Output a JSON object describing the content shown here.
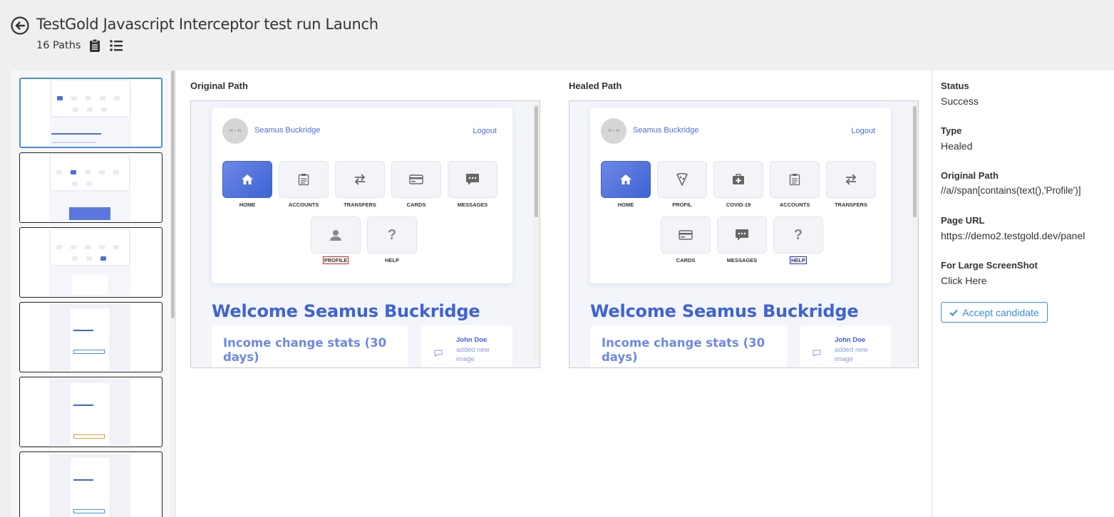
{
  "header": {
    "title": "TestGold Javascript Interceptor test run Launch",
    "paths_count": "16 Paths"
  },
  "panels": {
    "original_label": "Original Path",
    "healed_label": "Healed Path"
  },
  "app_preview": {
    "user_name": "Seamus Buckridge",
    "logout": "Logout",
    "welcome": "Welcome Seamus Buckridge",
    "income": "Income change stats (30 days)",
    "notif_name": "John Doe",
    "notif_msg": "added new image",
    "original_tiles": [
      "HOME",
      "ACCOUNTS",
      "TRANSFERS",
      "CARDS",
      "MESSAGES",
      "PROFILE",
      "HELP"
    ],
    "healed_tiles": [
      "HOME",
      "PROFIL",
      "COVID-19",
      "ACCOUNTS",
      "TRANSFERS",
      "CARDS",
      "MESSAGES",
      "HELP"
    ]
  },
  "details": {
    "status_label": "Status",
    "status_value": "Success",
    "type_label": "Type",
    "type_value": "Healed",
    "original_path_label": "Original Path",
    "original_path_value": "//a//span[contains(text(),'Profile')]",
    "page_url_label": "Page URL",
    "page_url_value": "https://demo2.testgold.dev/panel",
    "screenshot_label": "For Large ScreenShot",
    "screenshot_link": "Click Here",
    "accept_button": "Accept candidate"
  },
  "colors": {
    "accent": "#3e63d4",
    "button": "#3a8fd6",
    "selected_thumb": "#4a90d9"
  }
}
